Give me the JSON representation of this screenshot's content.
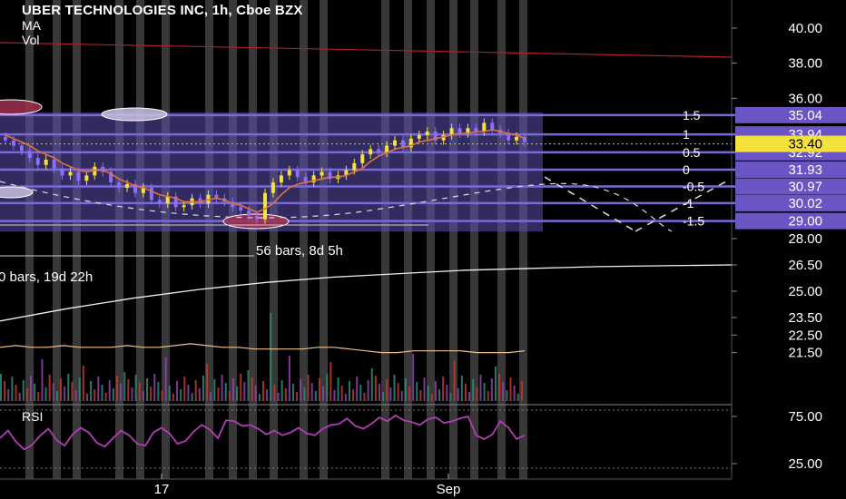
{
  "header": {
    "title": "UBER TECHNOLOGIES INC, 1h, Cboe BZX",
    "indicators": [
      "MA",
      "Vol"
    ]
  },
  "colors": {
    "background": "#000000",
    "candle_up": "#f5e13c",
    "candle_down": "#8f6bff",
    "ma_line": "#e0733a",
    "fib_band": "#5b4fae",
    "fib_line": "#7a6ad6",
    "session_shade": "#ffffff",
    "red_line": "#b01f2a",
    "rsi_line": "#b43cb4",
    "last_price_bg": "#f5e13c",
    "price_tag_bg": "#6b54c4"
  },
  "price_axis": {
    "ticks": [
      "40.00",
      "38.00",
      "36.00",
      "28.00",
      "26.50",
      "25.00",
      "23.50",
      "22.50",
      "21.50"
    ],
    "fib_tags": [
      "35.04",
      "33.94",
      "32.92",
      "31.93",
      "30.97",
      "30.02",
      "29.00"
    ],
    "last_price": "33.40"
  },
  "fib_levels": [
    "1.5",
    "1",
    "0.5",
    "0",
    "-0.5",
    "-1",
    "-1.5"
  ],
  "measurements": {
    "range_a": "56 bars, 8d 5h",
    "range_b": "0 bars, 19d 22h"
  },
  "rsi": {
    "label": "RSI",
    "ticks": [
      "75.00",
      "25.00"
    ]
  },
  "time_axis": {
    "labels": [
      "17",
      "Sep"
    ]
  },
  "chart_data": [
    {
      "type": "candlestick",
      "title": "UBER TECHNOLOGIES INC, 1h, Cboe BZX",
      "xlabel": "",
      "ylabel": "",
      "y_range": [
        20.8,
        41.0
      ],
      "grid": false,
      "series": [
        {
          "name": "MA",
          "close": [
            33.6,
            33.3,
            33.0,
            32.6,
            32.2,
            32.5,
            32.0,
            31.6,
            31.8,
            31.3,
            31.6,
            32.1,
            31.8,
            31.2,
            30.9,
            31.1,
            30.6,
            30.9,
            30.2,
            30.0,
            30.4,
            29.8,
            29.9,
            30.3,
            30.0,
            30.5,
            30.3,
            30.1,
            29.8,
            29.6,
            29.3,
            29.1,
            30.6,
            31.2,
            31.6,
            31.9,
            31.5,
            31.2,
            31.6,
            31.8,
            31.4,
            31.6,
            31.9,
            32.3,
            32.8,
            33.1,
            32.9,
            33.3,
            33.6,
            33.2,
            33.7,
            33.9,
            34.1,
            33.6,
            33.9,
            34.3,
            34.0,
            34.3,
            34.1,
            34.6,
            34.2,
            34.0,
            33.6,
            33.8,
            33.5
          ],
          "moving_average": [
            33.9,
            33.7,
            33.5,
            33.3,
            33.0,
            32.8,
            32.6,
            32.3,
            32.1,
            31.9,
            31.8,
            31.9,
            31.9,
            31.7,
            31.4,
            31.2,
            31.0,
            30.9,
            30.7,
            30.5,
            30.4,
            30.3,
            30.1,
            30.1,
            30.1,
            30.2,
            30.3,
            30.2,
            30.0,
            29.9,
            29.7,
            29.5,
            29.7,
            30.0,
            30.5,
            30.9,
            31.1,
            31.2,
            31.3,
            31.4,
            31.5,
            31.5,
            31.6,
            31.8,
            32.0,
            32.4,
            32.7,
            32.9,
            33.1,
            33.2,
            33.3,
            33.5,
            33.6,
            33.7,
            33.8,
            33.9,
            34.0,
            34.0,
            34.1,
            34.1,
            34.2,
            34.1,
            34.0,
            33.9,
            33.7
          ]
        },
        {
          "name": "Vol",
          "volume_ma": [
            21.8,
            21.9,
            21.8,
            21.8,
            21.9,
            21.8,
            21.8,
            21.8,
            21.9,
            21.8,
            21.8,
            21.9,
            22.0,
            21.9,
            21.8,
            21.8,
            21.7,
            21.7,
            21.7,
            21.7,
            21.8,
            21.8,
            21.7,
            21.6,
            21.5,
            21.5,
            21.6,
            21.6,
            21.6,
            21.6,
            21.5,
            21.5,
            21.5,
            21.6
          ],
          "trend": [
            23.3,
            24.0,
            24.6,
            25.1,
            25.5,
            25.8,
            26.0,
            26.2,
            26.3,
            26.4,
            26.45,
            26.5
          ]
        }
      ],
      "fib_prices": [
        35.04,
        33.94,
        32.92,
        31.93,
        30.97,
        30.02,
        29.0
      ],
      "last_price": 33.4
    },
    {
      "type": "line",
      "title": "RSI",
      "xlabel": "",
      "ylabel": "",
      "y_range": [
        15,
        85
      ],
      "series": [
        {
          "name": "RSI",
          "values": [
            52,
            60,
            48,
            40,
            45,
            55,
            62,
            50,
            44,
            56,
            63,
            58,
            47,
            43,
            52,
            60,
            55,
            46,
            44,
            58,
            63,
            57,
            46,
            49,
            59,
            66,
            61,
            52,
            71,
            70,
            65,
            66,
            62,
            56,
            60,
            55,
            58,
            63,
            57,
            55,
            62,
            66,
            67,
            73,
            65,
            62,
            67,
            74,
            70,
            76,
            71,
            69,
            66,
            72,
            74,
            68,
            70,
            73,
            75,
            55,
            51,
            56,
            70,
            63,
            51,
            55
          ]
        }
      ]
    }
  ]
}
